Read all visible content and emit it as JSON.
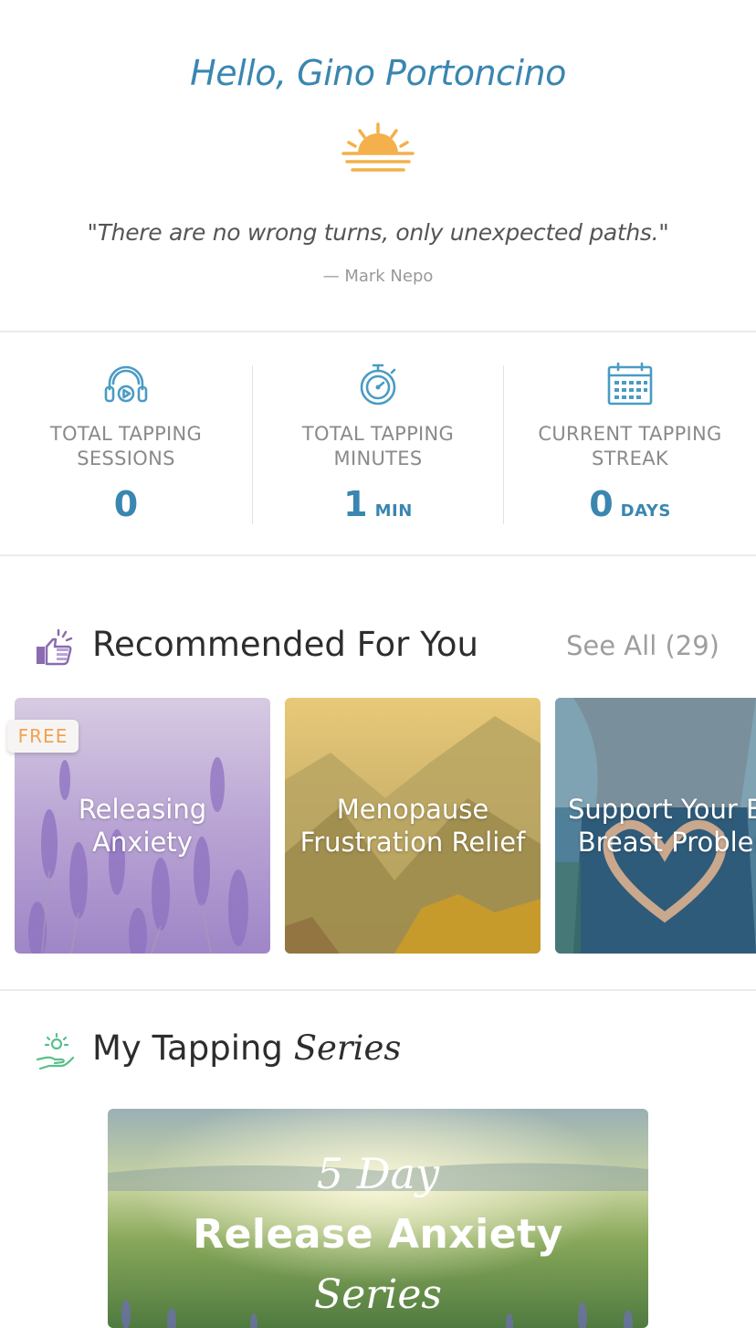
{
  "greeting": "Hello, Gino Portoncino",
  "quote": {
    "text": "\"There are no wrong turns, only unexpected paths.\"",
    "author": "— Mark Nepo"
  },
  "stats": [
    {
      "label": "TOTAL TAPPING\nSESSIONS",
      "value": "0",
      "unit": "",
      "icon": "headphones-play-icon"
    },
    {
      "label": "TOTAL TAPPING\nMINUTES",
      "value": "1",
      "unit": "MIN",
      "icon": "stopwatch-icon"
    },
    {
      "label": "CURRENT TAPPING\nSTREAK",
      "value": "0",
      "unit": "DAYS",
      "icon": "calendar-icon"
    }
  ],
  "recommended": {
    "title": "Recommended For You",
    "see_all": "See All (29)",
    "icon": "thumbs-up-icon",
    "cards": [
      {
        "title": "Releasing Anxiety",
        "badge": "FREE"
      },
      {
        "title": "Menopause\nFrustration Relief"
      },
      {
        "title": "Support Your Bo\nBreast Problen"
      }
    ]
  },
  "series": {
    "title_prefix": "My Tapping ",
    "title_script": "Series",
    "icon": "hand-sun-icon",
    "card": {
      "line1": "5 Day",
      "line2": "Release Anxiety",
      "line3": "Series"
    }
  },
  "colors": {
    "accent": "#3a86b0",
    "sun": "#f4b04a",
    "badge_text": "#f0a252",
    "purple_icon": "#8b6bb0",
    "green_icon": "#5bbf8a"
  }
}
